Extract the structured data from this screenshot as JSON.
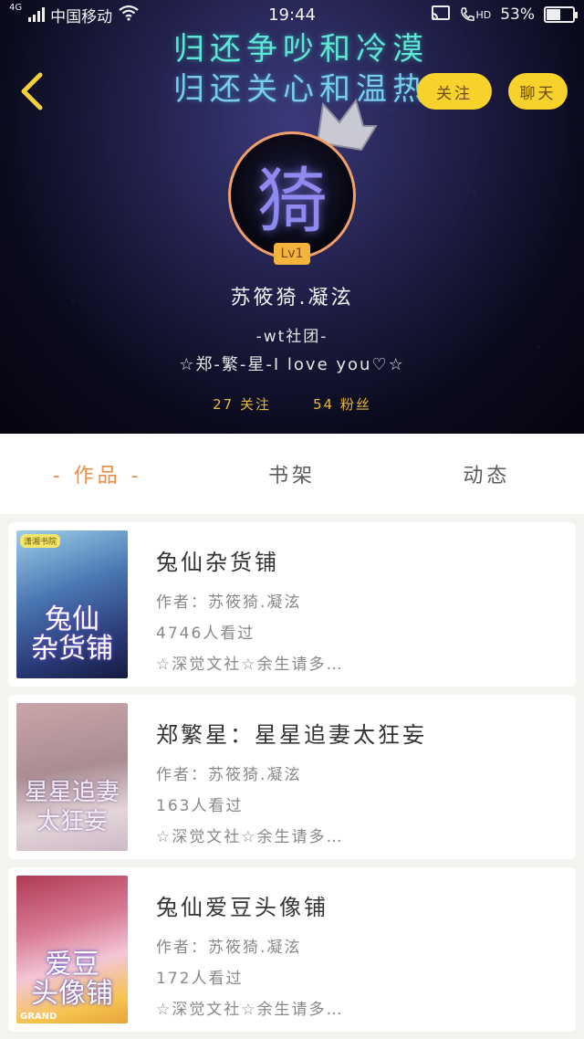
{
  "status_bar": {
    "network": "4G",
    "carrier": "中国移动",
    "time": "19:44",
    "hd": "HD",
    "battery_percent": "53%",
    "battery_level": 0.53
  },
  "header": {
    "slogan_line1": "归还争吵和冷漠",
    "slogan_line2": "归还关心和温热",
    "follow_label": "关注",
    "chat_label": "聊天"
  },
  "profile": {
    "avatar_glyph": "猗",
    "level": "Lv1",
    "username": "苏筱猗.凝泫",
    "bio_line1": "-wt社团-",
    "bio_line2": "☆郑-繁-星-I love you♡☆",
    "following": "27 关注",
    "fans": "54 粉丝"
  },
  "tabs": [
    {
      "label": "- 作品 -",
      "active": true
    },
    {
      "label": "书架",
      "active": false
    },
    {
      "label": "动态",
      "active": false
    }
  ],
  "books": [
    {
      "title": "兔仙杂货铺",
      "author": "作者：苏筱猗.凝泫",
      "views": "4746人看过",
      "tags": "☆深觉文社☆余生请多…",
      "cover_text": "兔仙\n杂货铺",
      "cover_tag": "潇湘书院"
    },
    {
      "title": "郑繁星：星星追妻太狂妄",
      "author": "作者：苏筱猗.凝泫",
      "views": "163人看过",
      "tags": "☆深觉文社☆余生请多…",
      "cover_text": "星星追妻\n太狂妄"
    },
    {
      "title": "兔仙爱豆头像铺",
      "author": "作者：苏筱猗.凝泫",
      "views": "172人看过",
      "tags": "☆深觉文社☆余生请多…",
      "cover_text": "爱豆\n头像铺",
      "cover_brand": "GRAND"
    }
  ]
}
